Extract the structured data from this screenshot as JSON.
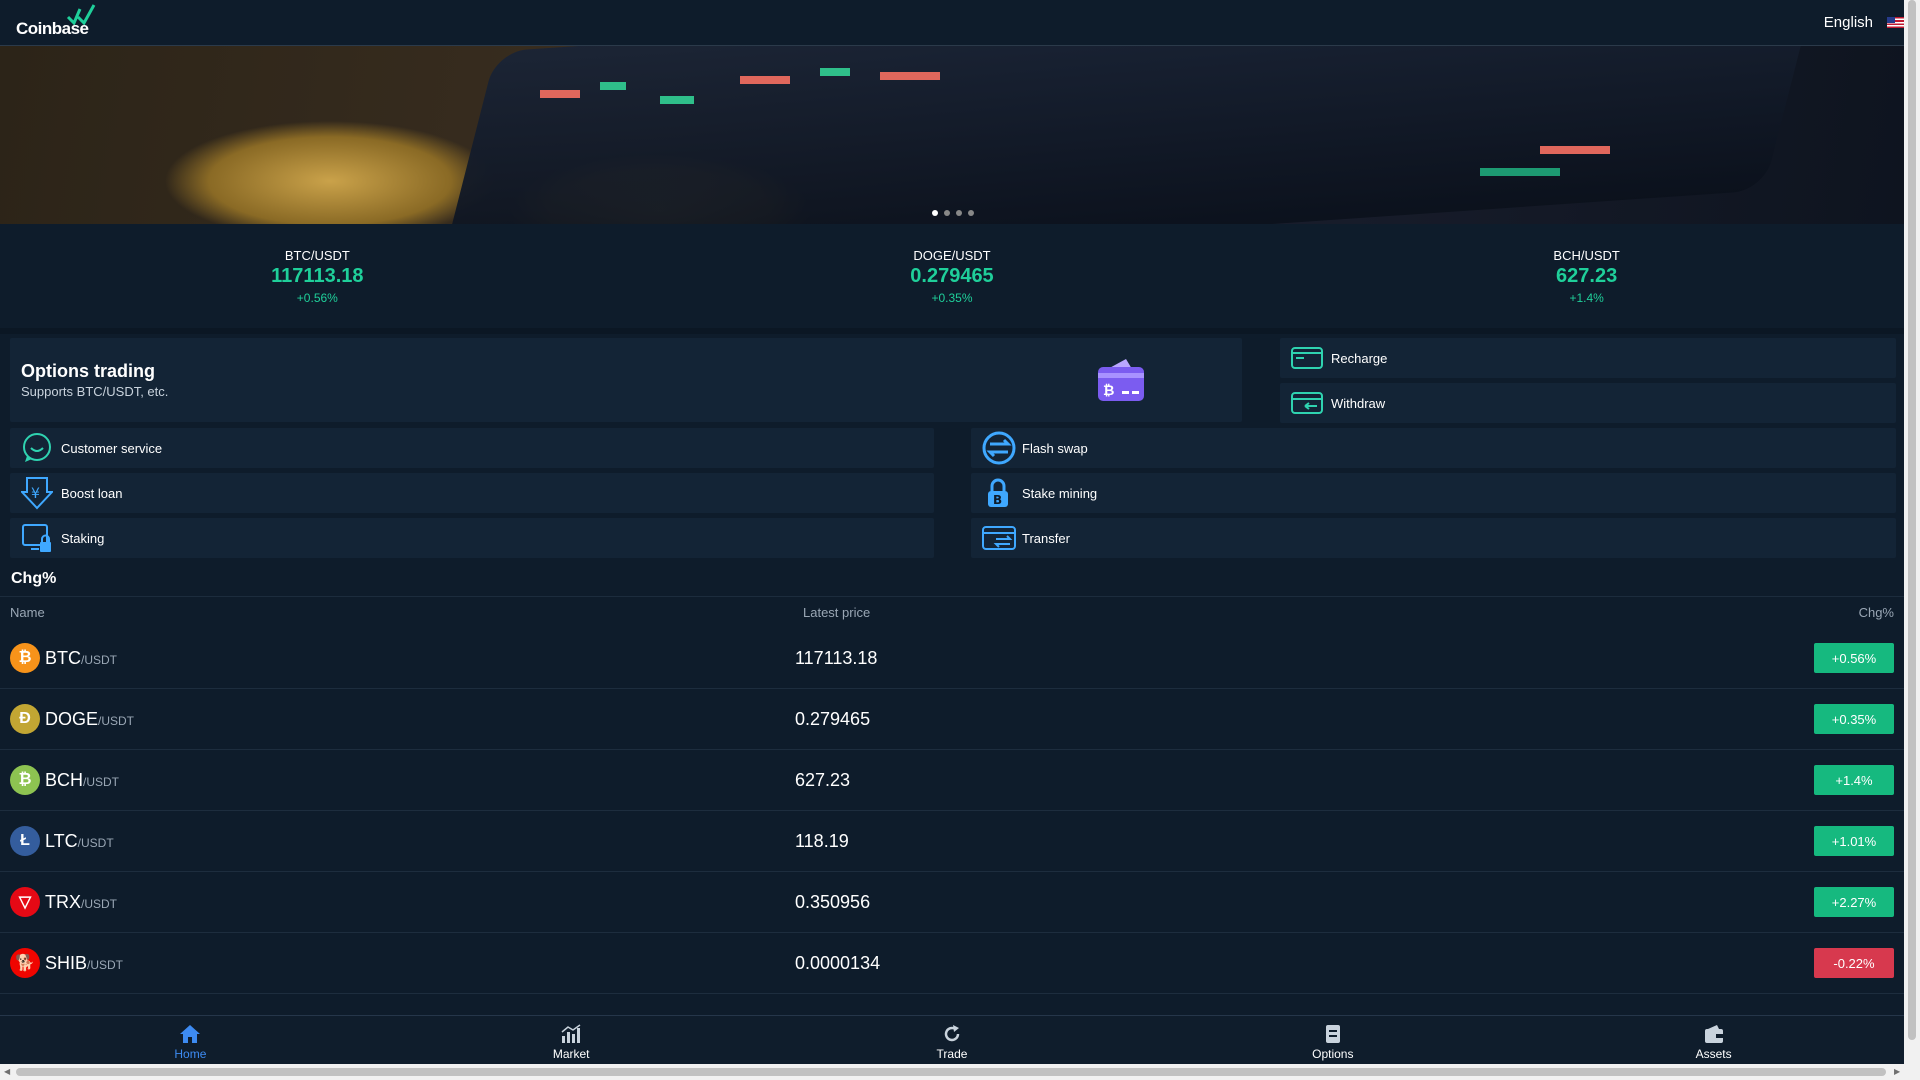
{
  "header": {
    "brand": "Coinbase",
    "language": "English"
  },
  "ticker": [
    {
      "pair": "BTC/USDT",
      "price": "117113.18",
      "chg": "+0.56%"
    },
    {
      "pair": "DOGE/USDT",
      "price": "0.279465",
      "chg": "+0.35%"
    },
    {
      "pair": "BCH/USDT",
      "price": "627.23",
      "chg": "+1.4%"
    }
  ],
  "options": {
    "title": "Options trading",
    "subtitle": "Supports BTC/USDT, etc."
  },
  "quick": {
    "recharge": "Recharge",
    "withdraw": "Withdraw",
    "customer_service": "Customer service",
    "flash_swap": "Flash swap",
    "boost_loan": "Boost loan",
    "stake_mining": "Stake mining",
    "staking": "Staking",
    "transfer": "Transfer"
  },
  "market": {
    "title": "Chg%",
    "col_name": "Name",
    "col_price": "Latest price",
    "col_chg": "Chg%",
    "quote": "/USDT",
    "rows": [
      {
        "symbol": "BTC",
        "price": "117113.18",
        "chg": "+0.56%",
        "color": "#f7931a",
        "glyph": "₿"
      },
      {
        "symbol": "DOGE",
        "price": "0.279465",
        "chg": "+0.35%",
        "color": "#c2a633",
        "glyph": "Ð"
      },
      {
        "symbol": "BCH",
        "price": "627.23",
        "chg": "+1.4%",
        "color": "#8dc351",
        "glyph": "₿"
      },
      {
        "symbol": "LTC",
        "price": "118.19",
        "chg": "+1.01%",
        "color": "#345d9d",
        "glyph": "Ł"
      },
      {
        "symbol": "TRX",
        "price": "0.350956",
        "chg": "+2.27%",
        "color": "#e50915",
        "glyph": "▽"
      },
      {
        "symbol": "SHIB",
        "price": "0.0000134",
        "chg": "-0.22%",
        "color": "#f00500",
        "glyph": "🐕"
      }
    ]
  },
  "nav": {
    "home": "Home",
    "market": "Market",
    "trade": "Trade",
    "options": "Options",
    "assets": "Assets"
  },
  "colors": {
    "accent": "#1fcf9a",
    "up": "#16b97f",
    "down": "#d7394e",
    "nav_active": "#3d8bf2",
    "bg": "#0e1c2b"
  }
}
